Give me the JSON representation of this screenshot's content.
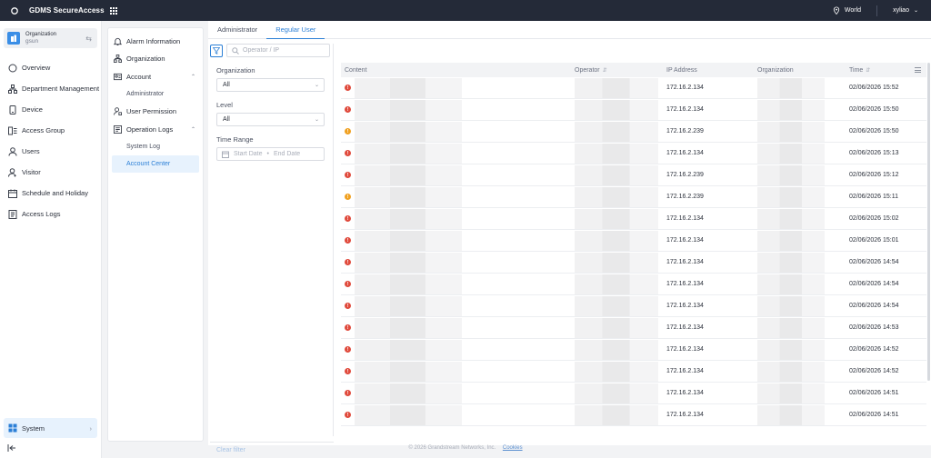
{
  "topbar": {
    "brand": "GDMS SecureAccess",
    "region": "World",
    "user": "xyliao"
  },
  "leftnav": {
    "org_label": "Organization",
    "org_name": "gsun",
    "items": [
      {
        "label": "Overview",
        "icon": "circle-icon"
      },
      {
        "label": "Department Management",
        "icon": "org-chart-icon"
      },
      {
        "label": "Device",
        "icon": "device-icon"
      },
      {
        "label": "Access Group",
        "icon": "access-group-icon"
      },
      {
        "label": "Users",
        "icon": "user-icon"
      },
      {
        "label": "Visitor",
        "icon": "visitor-icon"
      },
      {
        "label": "Schedule and Holiday",
        "icon": "calendar-icon"
      },
      {
        "label": "Access Logs",
        "icon": "logs-icon"
      }
    ],
    "system_label": "System"
  },
  "subnav": {
    "items": [
      {
        "label": "Alarm Information",
        "icon": "bell-icon"
      },
      {
        "label": "Organization",
        "icon": "org-chart-icon"
      },
      {
        "label": "Account",
        "icon": "account-icon"
      },
      {
        "label": "Administrator"
      },
      {
        "label": "User Permission",
        "icon": "user-permission-icon"
      },
      {
        "label": "Operation Logs",
        "icon": "operation-logs-icon"
      },
      {
        "label": "System Log"
      },
      {
        "label": "Account Center"
      }
    ]
  },
  "tabs": [
    "Administrator",
    "Regular User"
  ],
  "filters": {
    "search_placeholder": "Operator / IP",
    "organization_label": "Organization",
    "organization_value": "All",
    "level_label": "Level",
    "level_value": "All",
    "time_label": "Time Range",
    "start_placeholder": "Start Date",
    "end_placeholder": "End Date",
    "clear": "Clear filter"
  },
  "table": {
    "headers": {
      "content": "Content",
      "operator": "Operator",
      "ip": "IP Address",
      "organization": "Organization",
      "time": "Time"
    },
    "rows": [
      {
        "level": "red",
        "ip": "172.16.2.134",
        "time": "02/06/2026 15:52"
      },
      {
        "level": "red",
        "ip": "172.16.2.134",
        "time": "02/06/2026 15:50"
      },
      {
        "level": "orange",
        "ip": "172.16.2.239",
        "time": "02/06/2026 15:50"
      },
      {
        "level": "red",
        "ip": "172.16.2.134",
        "time": "02/06/2026 15:13"
      },
      {
        "level": "red",
        "ip": "172.16.2.239",
        "time": "02/06/2026 15:12"
      },
      {
        "level": "orange",
        "ip": "172.16.2.239",
        "time": "02/06/2026 15:11"
      },
      {
        "level": "red",
        "ip": "172.16.2.134",
        "time": "02/06/2026 15:02"
      },
      {
        "level": "red",
        "ip": "172.16.2.134",
        "time": "02/06/2026 15:01"
      },
      {
        "level": "red",
        "ip": "172.16.2.134",
        "time": "02/06/2026 14:54"
      },
      {
        "level": "red",
        "ip": "172.16.2.134",
        "time": "02/06/2026 14:54"
      },
      {
        "level": "red",
        "ip": "172.16.2.134",
        "time": "02/06/2026 14:54"
      },
      {
        "level": "red",
        "ip": "172.16.2.134",
        "time": "02/06/2026 14:53"
      },
      {
        "level": "red",
        "ip": "172.16.2.134",
        "time": "02/06/2026 14:52"
      },
      {
        "level": "red",
        "ip": "172.16.2.134",
        "time": "02/06/2026 14:52"
      },
      {
        "level": "red",
        "ip": "172.16.2.134",
        "time": "02/06/2026 14:51"
      },
      {
        "level": "red",
        "ip": "172.16.2.134",
        "time": "02/06/2026 14:51"
      }
    ]
  },
  "footer": {
    "copyright": "© 2026 Grandstream Networks, Inc.",
    "cookies": "Cookies"
  },
  "colors": {
    "accent": "#2b7fd6",
    "topbar": "#242a38",
    "error": "#e04a3c",
    "warning": "#f0a020"
  }
}
